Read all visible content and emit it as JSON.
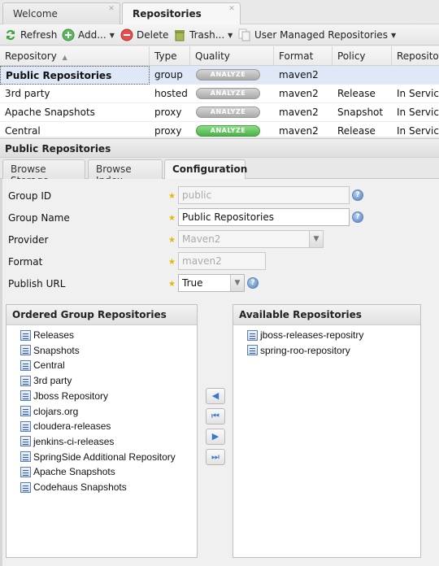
{
  "top_tabs": [
    {
      "label": "Welcome",
      "active": false
    },
    {
      "label": "Repositories",
      "active": true
    }
  ],
  "toolbar": {
    "refresh": "Refresh",
    "add": "Add...",
    "delete": "Delete",
    "trash": "Trash...",
    "user_managed": "User Managed Repositories"
  },
  "grid": {
    "columns": [
      "Repository",
      "Type",
      "Quality",
      "Format",
      "Policy",
      "Repository Status"
    ],
    "sort_column": "Repository",
    "sort_direction": "ascending",
    "analyze_label": "ANALYZE",
    "rows": [
      {
        "name": "Public Repositories",
        "type": "group",
        "quality": "ANALYZE",
        "quality_state": "gray",
        "format": "maven2",
        "policy": "",
        "status": "",
        "selected": true
      },
      {
        "name": "3rd party",
        "type": "hosted",
        "quality": "ANALYZE",
        "quality_state": "gray",
        "format": "maven2",
        "policy": "Release",
        "status": "In Service",
        "selected": false
      },
      {
        "name": "Apache Snapshots",
        "type": "proxy",
        "quality": "ANALYZE",
        "quality_state": "gray",
        "format": "maven2",
        "policy": "Snapshot",
        "status": "In Service",
        "selected": false
      },
      {
        "name": "Central",
        "type": "proxy",
        "quality": "ANALYZE",
        "quality_state": "green",
        "format": "maven2",
        "policy": "Release",
        "status": "In Service",
        "selected": false
      }
    ]
  },
  "detail": {
    "title": "Public Repositories",
    "tabs": [
      {
        "label": "Browse Storage",
        "active": false
      },
      {
        "label": "Browse Index",
        "active": false
      },
      {
        "label": "Configuration",
        "active": true
      }
    ],
    "form": {
      "group_id": {
        "label": "Group ID",
        "value": "public"
      },
      "group_name": {
        "label": "Group Name",
        "value": "Public Repositories"
      },
      "provider": {
        "label": "Provider",
        "value": "Maven2"
      },
      "format": {
        "label": "Format",
        "value": "maven2"
      },
      "publish_url": {
        "label": "Publish URL",
        "value": "True"
      }
    },
    "ordered": {
      "title": "Ordered Group Repositories",
      "items": [
        "Releases",
        "Snapshots",
        "Central",
        "3rd party",
        "Jboss Repository",
        "clojars.org",
        "cloudera-releases",
        "jenkins-ci-releases",
        "SpringSide Additional Repository",
        "Apache Snapshots",
        "Codehaus Snapshots"
      ]
    },
    "available": {
      "title": "Available Repositories",
      "items": [
        "jboss-releases-repositry",
        "spring-roo-repository"
      ]
    },
    "move_buttons": {
      "left": "◀",
      "first": "⏮",
      "right": "▶",
      "last": "⏭"
    }
  },
  "colors": {
    "selected_row": "#dfe8f6",
    "analyze_gray": "#a9a9a9",
    "analyze_green": "#4bb04a",
    "help_blue": "#4f7fc0",
    "required_star": "#e6b800"
  }
}
